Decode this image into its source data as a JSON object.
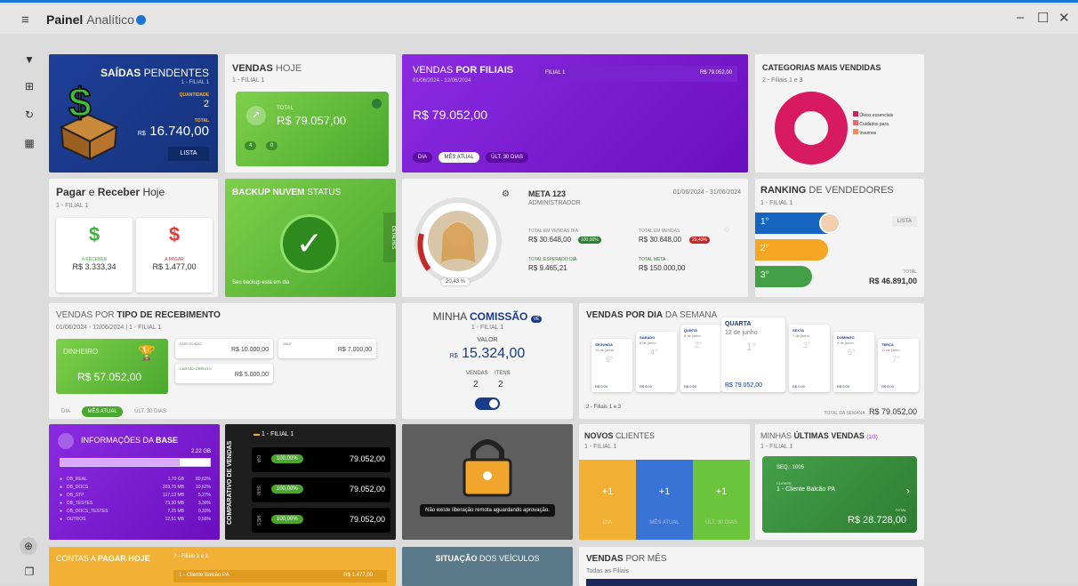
{
  "window": {
    "title_bold": "Painel",
    "title_light": "Analítico",
    "minimize": "–",
    "maximize": "☐",
    "close": "✕"
  },
  "sidebar": {
    "items": [
      "filter-icon",
      "chart-icon",
      "refresh-icon",
      "grid-icon",
      "zoom-icon",
      "copy-icon"
    ]
  },
  "saidas": {
    "t1": "SAÍDAS",
    "t2": "PENDENTES",
    "filial": "1 - FILIAL 1",
    "qtd_label": "QUANTIDADE",
    "qtd": "2",
    "total_label": "TOTAL",
    "cur": "R$",
    "total": "16.740,00",
    "btn": "LISTA"
  },
  "vendas_hoje": {
    "t1": "VENDAS",
    "t2": "HOJE",
    "filial": "1 - FILIAL 1",
    "total_label": "TOTAL",
    "total": "R$ 79.057,00",
    "b1": "4",
    "b2": "0"
  },
  "vendas_filiais": {
    "t1": "VENDAS",
    "t2": "POR FILIAIS",
    "date": "01/06/2024 - 12/06/2024",
    "total": "R$ 79.052,00",
    "bar_label": "FILIAL 1",
    "bar_value": "R$ 79.052,00",
    "bar_fill": 1.0,
    "tabs": [
      "DIA",
      "MÊS ATUAL",
      "ÚLT. 30 DIAS"
    ]
  },
  "categorias": {
    "title": "CATEGORIAS MAIS VENDIDAS",
    "filiais": "2 - Filiais 1 e 3",
    "legend": [
      "Óleos essenciais",
      "Cuidados para",
      "Insumos"
    ],
    "colors": [
      "#d81b60",
      "#ef6c6c",
      "#f28a5a"
    ]
  },
  "pagar": {
    "t1": "Pagar",
    "t2": "e",
    "t3": "Receber",
    "t4": "Hoje",
    "filial": "1 - FILIAL 1",
    "rec_label": "A RECEBER",
    "rec": "R$ 3.333,34",
    "pag_label": "A PAGAR",
    "pag": "R$ 1.477,00"
  },
  "backup": {
    "t1": "BACKUP NUVEM",
    "t2": "STATUS",
    "side": "DETALHES",
    "footer": "Seu backup está em dia"
  },
  "meta": {
    "title": "META 123",
    "role": "ADMINISTRADOR",
    "period": "01/06/2024 - 31/06/2024",
    "pct": "20,43 %",
    "l1": "TOTAL EM VENDAS DIA",
    "v1": "R$ 30.648,00",
    "b1": "100,00%",
    "l2": "TOTAL EM VENDAS",
    "v2": "R$ 30.648,00",
    "b2": "20,43%",
    "l3": "TOTAL ESPERADO DIA",
    "v3": "R$ 9.465,21",
    "l4": "TOTAL META",
    "v4": "R$ 150.000,00"
  },
  "ranking": {
    "t1": "RANKING",
    "t2": "DE VENDEDORES",
    "filial": "1 - FILIAL 1",
    "btn": "LISTA",
    "p1": "1°",
    "p2": "2°",
    "p3": "3°",
    "total_label": "TOTAL",
    "total": "R$ 46.891,00"
  },
  "recebimento": {
    "t1": "VENDAS POR",
    "t2": "TIPO DE RECEBIMENTO",
    "date": "01/06/2024 - 12/06/2024 | 1 - FILIAL 1",
    "main_label": "DINHEIRO",
    "main_value": "R$ 57.052,00",
    "c1l": "PARCELADO",
    "c1v": "R$ 10.000,00",
    "c2l": "VALE",
    "c2v": "R$ 7.000,00",
    "c3l": "CARTÃO CRÉDITO",
    "c3v": "R$ 5.000,00",
    "tabs": [
      "DIA",
      "MÊS ATUAL",
      "ÚLT. 30 DIAS"
    ]
  },
  "comissao": {
    "t1": "MINHA",
    "t2": "COMISSÃO",
    "badge": "VÊ",
    "filial": "1 - FILIAL 1",
    "valor_label": "VALOR",
    "cur": "R$",
    "valor": "15.324,00",
    "l1": "VENDAS",
    "l2": "ITENS",
    "v1": "2",
    "v2": "2"
  },
  "semana": {
    "t1": "VENDAS POR DIA",
    "t2": "DA SEMANA",
    "days": [
      {
        "n": "SEGUNDA",
        "d": "10 de junho",
        "r": "6°",
        "v": "R$ 0,00"
      },
      {
        "n": "SÁBADO",
        "d": "8 de junho",
        "r": "4°",
        "v": "R$ 0,00"
      },
      {
        "n": "QUINTA",
        "d": "6 de junho",
        "r": "2°",
        "v": "R$ 0,00"
      },
      {
        "n": "QUARTA",
        "d": "12 de junho",
        "r": "1°",
        "v": "R$ 79.052,00"
      },
      {
        "n": "SEXTA",
        "d": "7 de junho",
        "r": "3°",
        "v": "R$ 0,00"
      },
      {
        "n": "DOMINGO",
        "d": "9 de junho",
        "r": "5°",
        "v": "R$ 0,00"
      },
      {
        "n": "TERÇA",
        "d": "11 de junho",
        "r": "7°",
        "v": "R$ 0,00"
      }
    ],
    "filiais": "2 - Filiais 1 e 3",
    "total_label": "TOTAL DA SEMANA",
    "total": "R$ 79.052,00"
  },
  "base": {
    "t1": "INFORMAÇÕES DA",
    "t2": "BASE",
    "size": "2.22 GB",
    "rows": [
      [
        "DB_REAL",
        "1,79 GB",
        "80,63%"
      ],
      [
        "DB_DOCS",
        "203,75 MB",
        "10,62%"
      ],
      [
        "DB_STP",
        "117,13 MB",
        "5,27%"
      ],
      [
        "DB_TESTES",
        "73,30 MB",
        "3,30%"
      ],
      [
        "DB_DOCS_TESTES",
        "7,25 MB",
        "0,33%"
      ],
      [
        "OUTROS",
        "12,51 MB",
        "0,56%"
      ]
    ]
  },
  "comparativo": {
    "side": "COMPARATIVO DE VENDAS",
    "filial": "1 - FILIAL 1",
    "rows": [
      {
        "l": "DIA",
        "p": "100,00%",
        "v": "79.052,00"
      },
      {
        "l": "SEM",
        "p": "100,00%",
        "v": "79.052,00"
      },
      {
        "l": "MÊS",
        "p": "100,00%",
        "v": "79.052,00"
      }
    ]
  },
  "liberacao": {
    "msg": "Não existe liberação remota aguardando aprovação."
  },
  "clientes": {
    "t1": "NOVOS",
    "t2": "CLIENTES",
    "filial": "1 - FILIAL 1",
    "cols": [
      {
        "v": "+1",
        "l": "DIA"
      },
      {
        "v": "+1",
        "l": "MÊS ATUAL"
      },
      {
        "v": "+1",
        "l": "ÚLT. 30 DIAS"
      }
    ]
  },
  "ultimas": {
    "t1": "MINHAS",
    "t2": "ÚLTIMAS VENDAS",
    "pages": "(1/3)",
    "filial": "1 - FILIAL 1",
    "seq": "SEQ.: 1005",
    "cliente_label": "CLIENTE",
    "cliente": "1 - Cliente Balcão PA",
    "total_label": "TOTAL",
    "total": "R$ 28.728,00"
  },
  "contas": {
    "t1": "CONTAS A",
    "t2": "PAGAR HOJE",
    "filiais": "2 - Filiais 1 e 3",
    "row": "1 - Cliente Balcão PA",
    "row_v": "R$ 1.477,00"
  },
  "veiculos": {
    "t1": "SITUAÇÃO",
    "t2": "DOS VEÍCULOS"
  },
  "vendas_mes": {
    "t1": "VENDAS",
    "t2": "POR MÊS",
    "filiais": "Todas as Filiais"
  }
}
